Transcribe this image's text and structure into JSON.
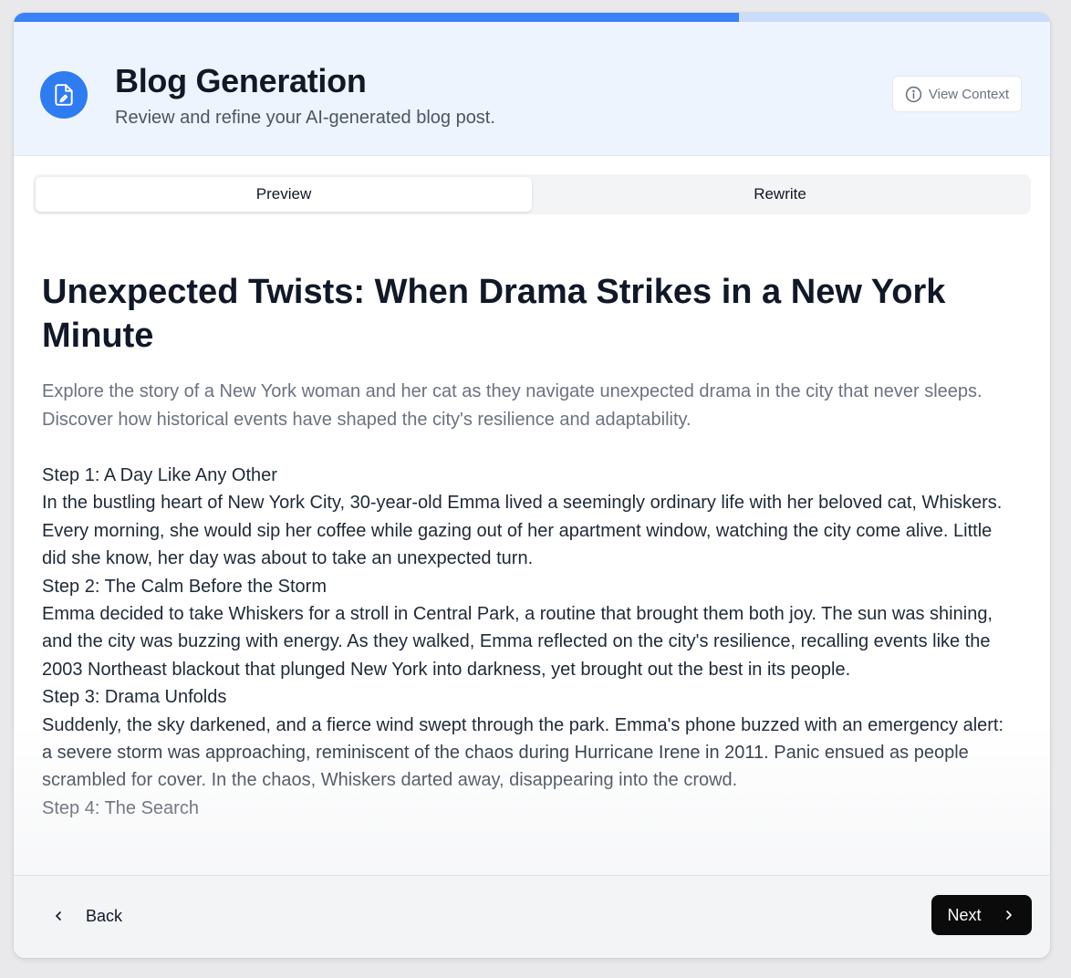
{
  "progress": {
    "fraction": 0.7
  },
  "header": {
    "icon": "document-edit-icon",
    "title": "Blog Generation",
    "subtitle": "Review and refine your AI-generated blog post.",
    "view_context_label": "View Context",
    "view_context_icon": "info-circle-icon"
  },
  "tabs": [
    {
      "label": "Preview",
      "active": true
    },
    {
      "label": "Rewrite",
      "active": false
    }
  ],
  "post": {
    "title": "Unexpected Twists: When Drama Strikes in a New York Minute",
    "summary": "Explore the story of a New York woman and her cat as they navigate unexpected drama in the city that never sleeps. Discover how historical events have shaped the city's resilience and adaptability.",
    "body": [
      "Step 1: A Day Like Any Other",
      "In the bustling heart of New York City, 30-year-old Emma lived a seemingly ordinary life with her beloved cat, Whiskers. Every morning, she would sip her coffee while gazing out of her apartment window, watching the city come alive. Little did she know, her day was about to take an unexpected turn.",
      "Step 2: The Calm Before the Storm",
      "Emma decided to take Whiskers for a stroll in Central Park, a routine that brought them both joy. The sun was shining, and the city was buzzing with energy. As they walked, Emma reflected on the city's resilience, recalling events like the 2003 Northeast blackout that plunged New York into darkness, yet brought out the best in its people.",
      "Step 3: Drama Unfolds",
      "Suddenly, the sky darkened, and a fierce wind swept through the park. Emma's phone buzzed with an emergency alert: a severe storm was approaching, reminiscent of the chaos during Hurricane Irene in 2011. Panic ensued as people scrambled for cover. In the chaos, Whiskers darted away, disappearing into the crowd.",
      "Step 4: The Search"
    ]
  },
  "footer": {
    "back_label": "Back",
    "next_label": "Next"
  },
  "colors": {
    "accent": "#3b82f6",
    "progress_track": "#c9dcfb",
    "header_bg": "#eef4fe",
    "next_button_bg": "#0b0b0c"
  }
}
